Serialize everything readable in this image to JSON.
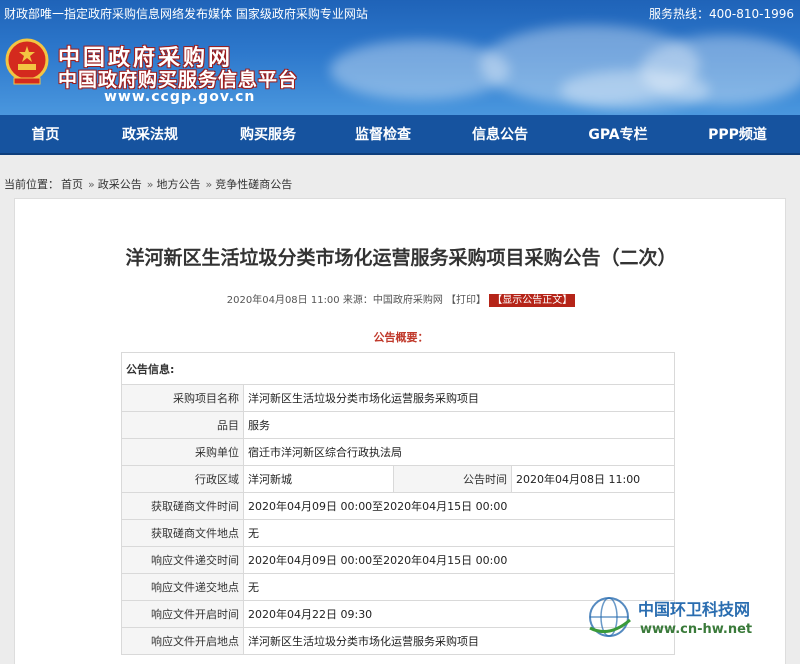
{
  "header": {
    "topbar_left": "财政部唯一指定政府采购信息网络发布媒体 国家级政府采购专业网站",
    "topbar_right": "服务热线：400-810-1996",
    "logo_line1": "中国政府采购网",
    "logo_line2": "中国政府购买服务信息平台",
    "logo_url": "www.ccgp.gov.cn"
  },
  "nav": {
    "items": [
      "首页",
      "政采法规",
      "购买服务",
      "监督检查",
      "信息公告",
      "GPA专栏",
      "PPP频道"
    ]
  },
  "breadcrumb": {
    "prefix": "当前位置：",
    "items": [
      "首页",
      "政采公告",
      "地方公告",
      "竞争性磋商公告"
    ],
    "sep": "»"
  },
  "article": {
    "title": "洋河新区生活垃圾分类市场化运营服务采购项目采购公告（二次）",
    "date": "2020年04月08日 11:00",
    "source": "来源：中国政府采购网",
    "print": "【打印】",
    "show_text": "【显示公告正文】",
    "summary_title": "公告概要："
  },
  "table": {
    "header": "公告信息:",
    "rows": [
      {
        "label": "采购项目名称",
        "value": "洋河新区生活垃圾分类市场化运营服务采购项目"
      },
      {
        "label": "品目",
        "value": "服务"
      },
      {
        "label": "采购单位",
        "value": "宿迁市洋河新区综合行政执法局"
      },
      {
        "label": "行政区域",
        "value": "洋河新城",
        "label2": "公告时间",
        "value2": "2020年04月08日 11:00"
      },
      {
        "label": "获取磋商文件时间",
        "value": "2020年04月09日 00:00至2020年04月15日 00:00"
      },
      {
        "label": "获取磋商文件地点",
        "value": "无"
      },
      {
        "label": "响应文件递交时间",
        "value": "2020年04月09日 00:00至2020年04月15日 00:00"
      },
      {
        "label": "响应文件递交地点",
        "value": "无"
      },
      {
        "label": "响应文件开启时间",
        "value": "2020年04月22日 09:30"
      },
      {
        "label": "响应文件开启地点",
        "value": "洋河新区生活垃圾分类市场化运营服务采购项目"
      }
    ]
  },
  "watermark": {
    "name": "中国环卫科技网",
    "url": "www.cn-hw.net"
  }
}
